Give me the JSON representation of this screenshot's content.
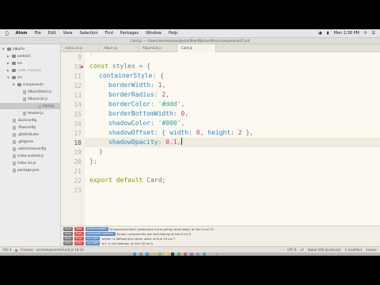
{
  "menubar": {
    "apple": "",
    "items": [
      "Atom",
      "File",
      "Edit",
      "View",
      "Selection",
      "Find",
      "Packages",
      "Window",
      "Help"
    ],
    "clock": "Mon 2:38 PM"
  },
  "title": "Card.js — /Users/someone/projects/ReactNativeUI/src/components/Card",
  "sidebar": {
    "items": [
      "albums",
      "android",
      "ios",
      "node_modules",
      "src",
      "components",
      "AlbumDetail.js",
      "AlbumList.js",
      "Card.js",
      "Header.js",
      ".buckconfig",
      ".flowconfig",
      ".gitattributes",
      ".gitignore",
      ".watchmanconfig",
      "index.android.js",
      "index.ios.js",
      "package.json"
    ]
  },
  "tabs": [
    "index.ios.js",
    "Album.js",
    "AlbumList.js",
    "Card.js"
  ],
  "editor": {
    "line_numbers": [
      "9",
      "10",
      "11",
      "12",
      "13",
      "14",
      "15",
      "16",
      "17",
      "18",
      "19",
      "20",
      "21",
      "22",
      "23"
    ],
    "current_line": "18",
    "lines": {
      "l9": "`",
      "l10_kw": "const",
      "l10_rest": " styles = {",
      "l11_prop": "containerStyle",
      "l11_rest": ": {",
      "l12_prop": "borderWidth",
      "l12_val": "1",
      "l13_prop": "borderRadius",
      "l13_val": "2",
      "l14_prop": "borderColor",
      "l14_val": "'#ddd'",
      "l15_prop": "borderBottomWidth",
      "l15_val": "0",
      "l16_prop": "shadowColor",
      "l16_val": "'#000'",
      "l17_prop": "shadowOffset",
      "l17_rest1": ": { ",
      "l17_p2": "width",
      "l17_v2": "0",
      "l17_p3": "height",
      "l17_v3": "2",
      "l17_end": " },",
      "l18_prop": "shadowOpacity",
      "l18_val": "0.1",
      "l19": "}",
      "l20": "};",
      "l22_kw1": "export",
      "l22_kw2": "default",
      "l22_rest": " Card;"
    }
  },
  "lint": [
    {
      "level": "Error",
      "rule": "prefer-template",
      "msg": "Unexpected block statement surrounding arrow body. at line 4 col 22"
    },
    {
      "level": "Error",
      "rule": "react/prefer-stateless",
      "msg": "Empty components are self-closing at line 6 col 5"
    },
    {
      "level": "Error",
      "rule": "no-undef",
      "msg": "'styles' is defined but never used. at line 10 col 7"
    },
    {
      "level": "Error",
      "rule": "no-undef",
      "msg": "'err' is not defined. at line 18 col 5"
    }
  ],
  "status": {
    "file_count": "File 4",
    "issues": "4 Issues",
    "path": "src/components/Card.js  18:33",
    "encoding": "UTF-8",
    "eol": "LF",
    "grammar": "Babel ES6 JavaScript",
    "git": "1 modified",
    "branch": "master"
  }
}
